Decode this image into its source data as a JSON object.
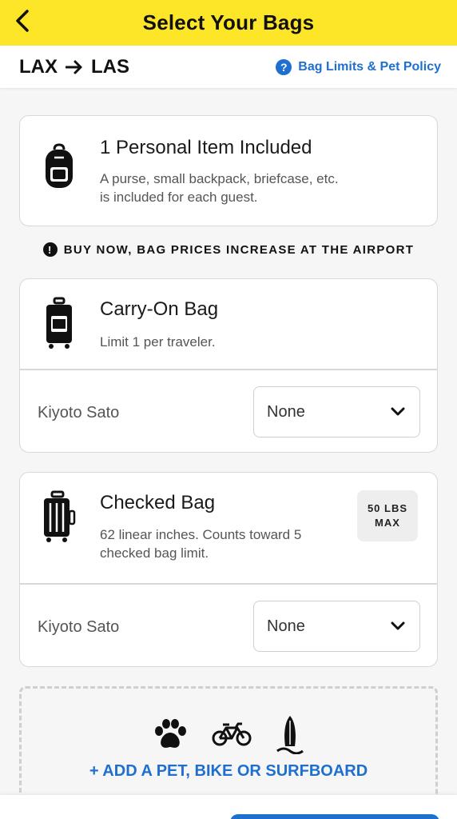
{
  "header": {
    "title": "Select Your Bags",
    "back_icon": "chevron-left-icon"
  },
  "route": {
    "origin": "LAX",
    "destination": "LAS",
    "arrow_icon": "arrow-right-icon",
    "policy_link": "Bag Limits & Pet Policy",
    "policy_icon": "question-circle-icon"
  },
  "personal_item": {
    "title": "1 Personal Item Included",
    "description_line1": "A purse, small backpack, briefcase, etc.",
    "description_line2": "is included for each guest.",
    "icon": "backpack-icon"
  },
  "warning": {
    "text": "BUY NOW, BAG PRICES INCREASE AT THE AIRPORT",
    "icon": "exclamation-circle-icon"
  },
  "carry_on": {
    "title": "Carry-On Bag",
    "description": "Limit 1 per traveler.",
    "icon": "carry-on-suitcase-icon",
    "traveler": "Kiyoto Sato",
    "selected": "None"
  },
  "checked": {
    "title": "Checked Bag",
    "description_line1": "62 linear inches. Counts toward 5",
    "description_line2": "checked bag limit.",
    "icon": "checked-suitcase-icon",
    "badge_line1": "50 LBS",
    "badge_line2": "MAX",
    "traveler": "Kiyoto Sato",
    "selected": "None"
  },
  "special_items": {
    "icons": [
      "paw-icon",
      "bicycle-icon",
      "surfboard-icon"
    ],
    "link": "+ ADD A PET, BIKE OR SURFBOARD"
  },
  "colors": {
    "header_yellow": "#fde528",
    "link_blue": "#1f6fcf"
  }
}
